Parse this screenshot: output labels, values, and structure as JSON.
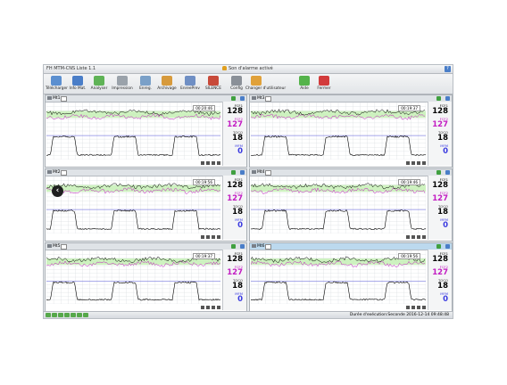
{
  "window": {
    "title": "FH MTM-CNS Liste 1.1",
    "alarm_status": "Son d'alarme activé",
    "help": "?"
  },
  "toolbar": [
    {
      "label": "Télécharger",
      "icon": "download-icon",
      "color": "#5b8fd0"
    },
    {
      "label": "Info Mat.",
      "icon": "info-icon",
      "color": "#4a7ec8"
    },
    {
      "label": "Analyser",
      "icon": "analyze-icon",
      "color": "#5fb356"
    },
    {
      "label": "Impression",
      "icon": "printer-icon",
      "color": "#9aa2aa"
    },
    {
      "label": "Enreg.",
      "icon": "save-icon",
      "color": "#7aa0c8"
    },
    {
      "label": "Archivage",
      "icon": "archive-icon",
      "color": "#d79a3c"
    },
    {
      "label": "EnreePrev",
      "icon": "record-icon",
      "color": "#6f8fc4"
    },
    {
      "label": "SILENCE",
      "icon": "silence-icon",
      "color": "#c84a3a"
    },
    {
      "label": "Config",
      "icon": "gear-icon",
      "color": "#8a9098"
    },
    {
      "label": "Changer d'utilisateur",
      "icon": "user-switch-icon",
      "color": "#e0a13a"
    },
    {
      "label": "Aide",
      "icon": "help-icon",
      "color": "#55b34b"
    },
    {
      "label": "Fermer",
      "icon": "close-icon",
      "color": "#d23b3b"
    }
  ],
  "panes": [
    {
      "bed": "Mt1",
      "time": "00:20:46",
      "fcf1": "128",
      "fcf2": "127",
      "toco": "18",
      "mfm": "0",
      "highlight": false
    },
    {
      "bed": "Mt3",
      "time": "00:19:37",
      "fcf1": "128",
      "fcf2": "127",
      "toco": "18",
      "mfm": "0",
      "highlight": false
    },
    {
      "bed": "Mt2",
      "time": "00:19:56",
      "fcf1": "128",
      "fcf2": "127",
      "toco": "18",
      "mfm": "0",
      "highlight": false
    },
    {
      "bed": "Mt4",
      "time": "00:19:46",
      "fcf1": "128",
      "fcf2": "127",
      "toco": "18",
      "mfm": "0",
      "highlight": false
    },
    {
      "bed": "Mt5",
      "time": "00:19:37",
      "fcf1": "128",
      "fcf2": "127",
      "toco": "18",
      "mfm": "0",
      "highlight": false
    },
    {
      "bed": "Mt6",
      "time": "00:19:56",
      "fcf1": "128",
      "fcf2": "127",
      "toco": "18",
      "mfm": "0",
      "highlight": true
    }
  ],
  "labels": {
    "fcf1": "FCF1",
    "fcf2": "FCF2",
    "toco": "TOCO",
    "mfm": "MFM"
  },
  "status_text": "Durée d'exécution:Seconde 2016-12-14 09:48:48",
  "colors": {
    "fcf1": "#000000",
    "fcf2": "#c21bc2",
    "toco": "#000000",
    "mfm": "#3a3ae0",
    "band": "#c9f1b9",
    "grid": "#d3d7db"
  }
}
